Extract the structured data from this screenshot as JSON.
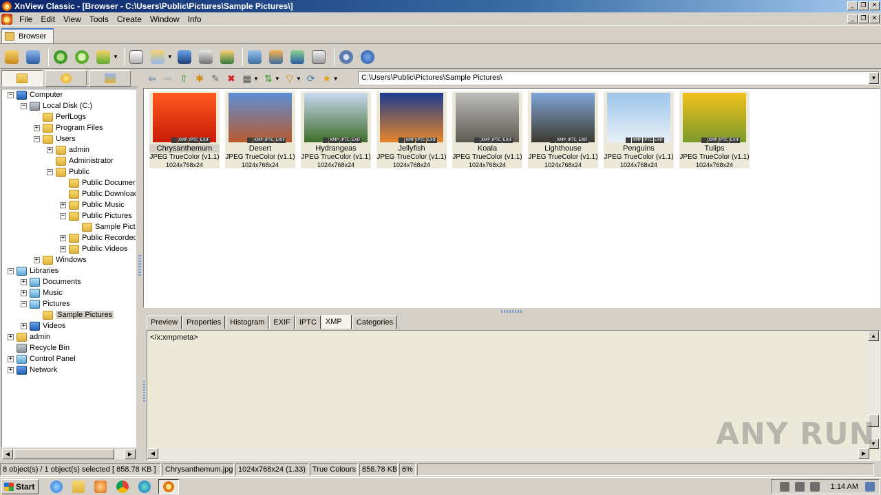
{
  "window": {
    "title": "XnView Classic - [Browser - C:\\Users\\Public\\Pictures\\Sample Pictures\\]"
  },
  "menu": [
    "File",
    "Edit",
    "View",
    "Tools",
    "Create",
    "Window",
    "Info"
  ],
  "tabs": {
    "browser": "Browser"
  },
  "path": "C:\\Users\\Public\\Pictures\\Sample Pictures\\",
  "tree": [
    {
      "label": "Computer",
      "icon": "computer-icon",
      "exp": "−"
    },
    {
      "label": "Local Disk (C:)",
      "icon": "drive-icon",
      "exp": "−"
    },
    {
      "label": "PerfLogs",
      "icon": "folder-icon",
      "exp": ""
    },
    {
      "label": "Program Files",
      "icon": "folder-icon",
      "exp": "+"
    },
    {
      "label": "Users",
      "icon": "folder-icon",
      "exp": "−"
    },
    {
      "label": "admin",
      "icon": "folder-icon",
      "exp": "+"
    },
    {
      "label": "Administrator",
      "icon": "folder-icon",
      "exp": ""
    },
    {
      "label": "Public",
      "icon": "folder-icon",
      "exp": "−"
    },
    {
      "label": "Public Documents",
      "icon": "folder-icon",
      "exp": ""
    },
    {
      "label": "Public Downloads",
      "icon": "folder-icon",
      "exp": ""
    },
    {
      "label": "Public Music",
      "icon": "folder-icon",
      "exp": "+"
    },
    {
      "label": "Public Pictures",
      "icon": "folder-icon",
      "exp": "−"
    },
    {
      "label": "Sample Pictures",
      "icon": "folder-icon",
      "exp": ""
    },
    {
      "label": "Public Recorded TV",
      "icon": "folder-icon",
      "exp": "+"
    },
    {
      "label": "Public Videos",
      "icon": "folder-icon",
      "exp": "+"
    },
    {
      "label": "Windows",
      "icon": "folder-icon",
      "exp": "+"
    },
    {
      "label": "Libraries",
      "icon": "library-icon",
      "exp": "−"
    },
    {
      "label": "Documents",
      "icon": "library-icon",
      "exp": "+"
    },
    {
      "label": "Music",
      "icon": "music-icon",
      "exp": "+"
    },
    {
      "label": "Pictures",
      "icon": "library-icon",
      "exp": "−"
    },
    {
      "label": "Sample Pictures",
      "icon": "folder-icon",
      "exp": ""
    },
    {
      "label": "Videos",
      "icon": "video-icon",
      "exp": "+"
    },
    {
      "label": "admin",
      "icon": "user-icon",
      "exp": "+"
    },
    {
      "label": "Recycle Bin",
      "icon": "recycle-bin-icon",
      "exp": ""
    },
    {
      "label": "Control Panel",
      "icon": "control-panel-icon",
      "exp": "+"
    },
    {
      "label": "Network",
      "icon": "network-icon",
      "exp": "+"
    }
  ],
  "thumbnails": [
    {
      "name": "Chrysanthemum",
      "format": "JPEG TrueColor (v1.1)",
      "dims": "1024x768x24",
      "colors": [
        "#ff5a1f",
        "#c91a08"
      ]
    },
    {
      "name": "Desert",
      "format": "JPEG TrueColor (v1.1)",
      "dims": "1024x768x24",
      "colors": [
        "#5d8fd6",
        "#b85a2c"
      ]
    },
    {
      "name": "Hydrangeas",
      "format": "JPEG TrueColor (v1.1)",
      "dims": "1024x768x24",
      "colors": [
        "#c9d9f0",
        "#3d6e2a"
      ]
    },
    {
      "name": "Jellyfish",
      "format": "JPEG TrueColor (v1.1)",
      "dims": "1024x768x24",
      "colors": [
        "#1b3b8f",
        "#e8862a"
      ]
    },
    {
      "name": "Koala",
      "format": "JPEG TrueColor (v1.1)",
      "dims": "1024x768x24",
      "colors": [
        "#bdbdbd",
        "#5e5a52"
      ]
    },
    {
      "name": "Lighthouse",
      "format": "JPEG TrueColor (v1.1)",
      "dims": "1024x768x24",
      "colors": [
        "#7fa6d8",
        "#3d3a2e"
      ]
    },
    {
      "name": "Penguins",
      "format": "JPEG TrueColor (v1.1)",
      "dims": "1024x768x24",
      "colors": [
        "#9cc4ea",
        "#e8f0f8"
      ]
    },
    {
      "name": "Tulips",
      "format": "JPEG TrueColor (v1.1)",
      "dims": "1024x768x24",
      "colors": [
        "#f2c21b",
        "#7a9a2a"
      ]
    }
  ],
  "badges": [
    "XMP",
    "IPTC",
    "EXIF"
  ],
  "info_tabs": [
    "Preview",
    "Properties",
    "Histogram",
    "EXIF",
    "IPTC",
    "XMP",
    "Categories"
  ],
  "info_content": "</x:xmpmeta>",
  "status": {
    "objects": "8 object(s) / 1 object(s) selected  [ 858.78 KB ]",
    "filename": "Chrysanthemum.jpg",
    "dims": "1024x768x24 (1.33)",
    "colors": "True Colours",
    "size": "858.78 KB",
    "zoom": "6%"
  },
  "taskbar": {
    "start": "Start",
    "clock": "1:14 AM"
  },
  "watermark": "ANY RUN"
}
